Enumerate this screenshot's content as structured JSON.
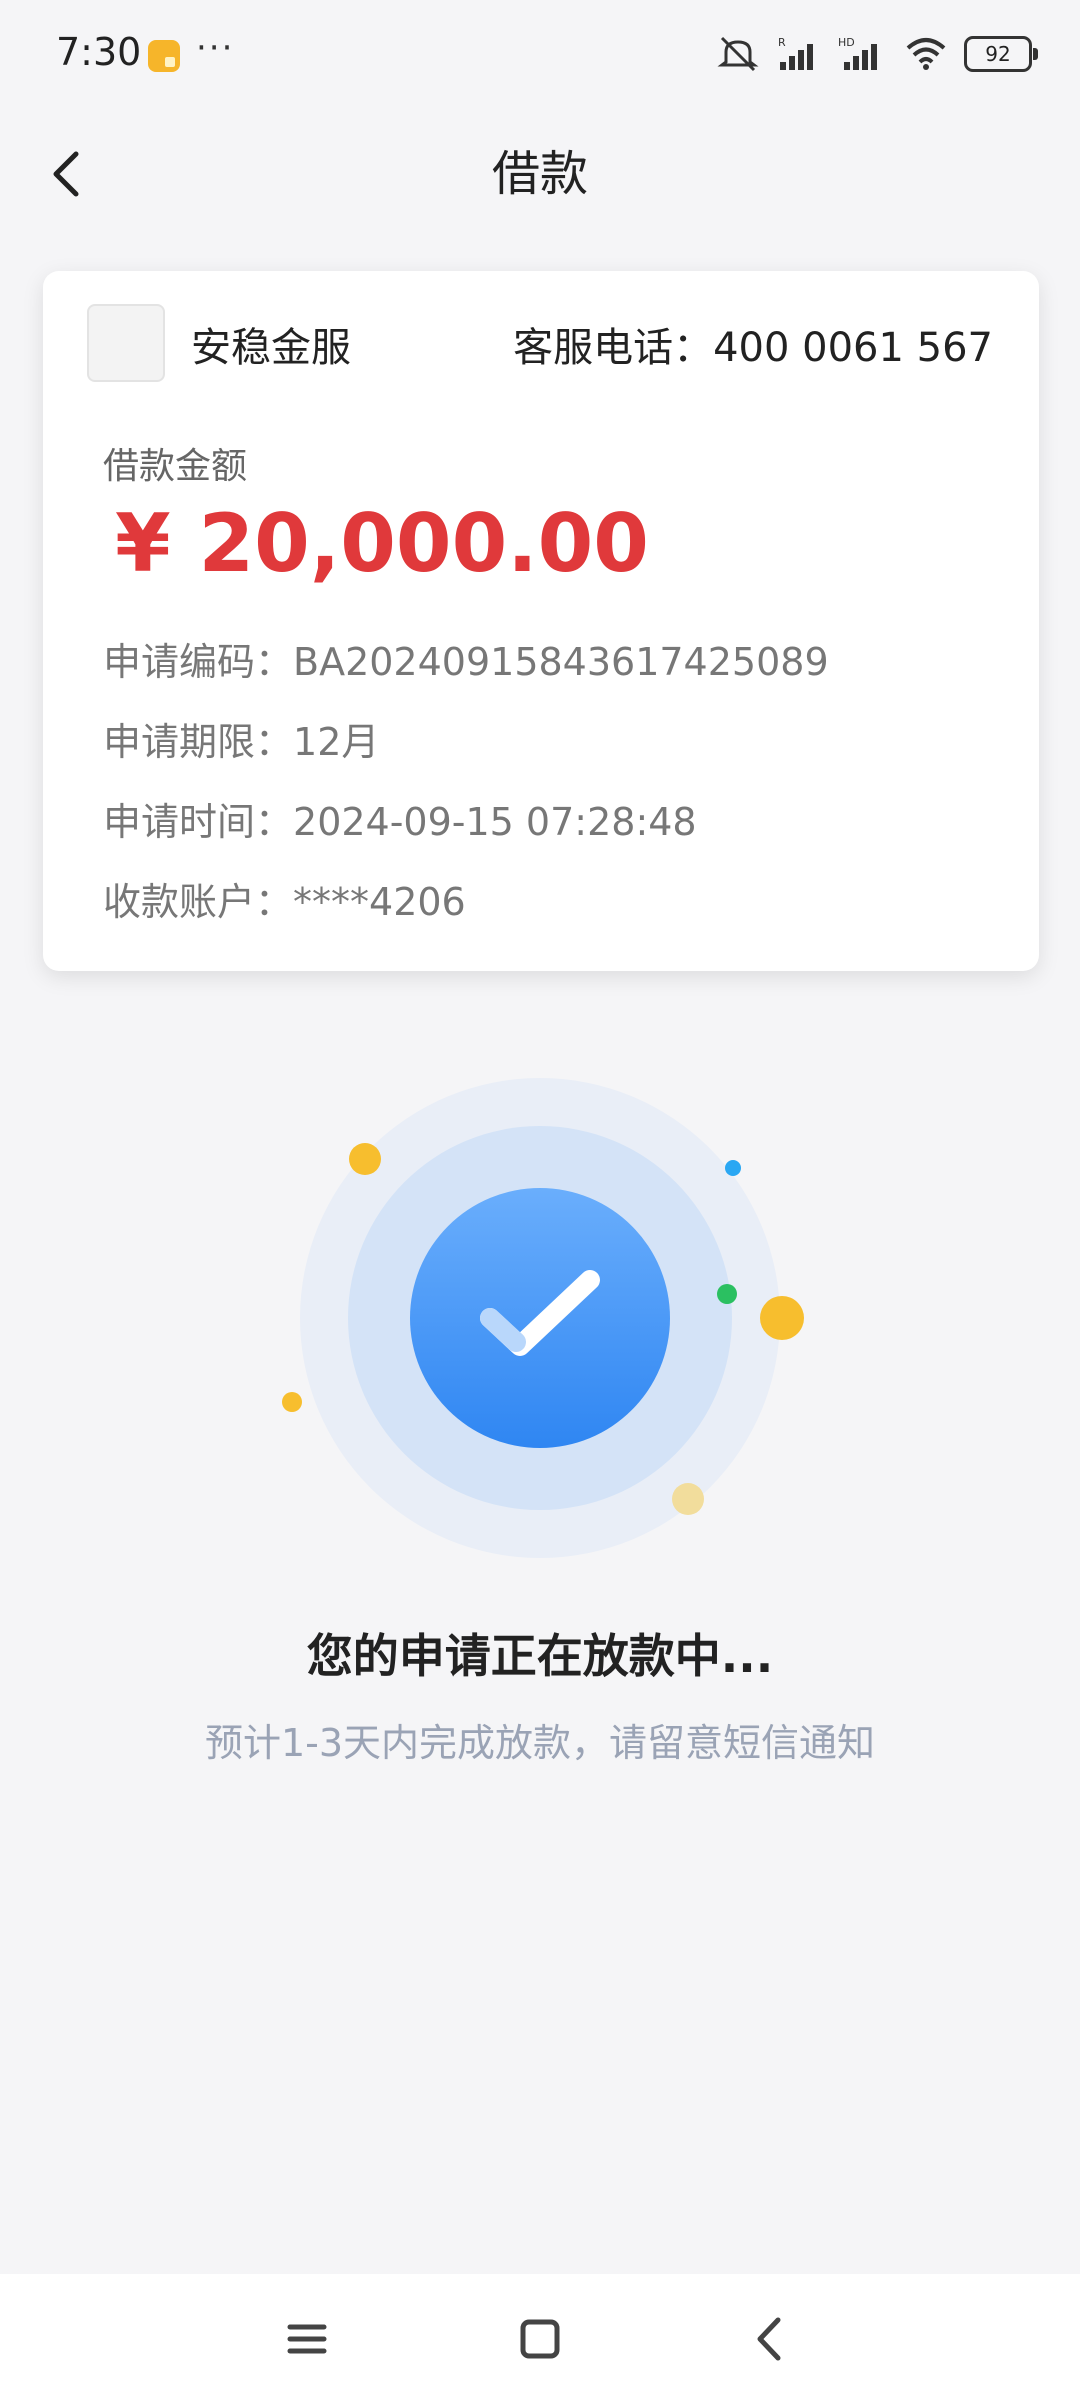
{
  "status_bar": {
    "time": "7:30",
    "dots": "···",
    "battery": "92",
    "icons": [
      "notification-icon",
      "mute-icon",
      "signal-r-icon",
      "signal-hd-icon",
      "wifi-icon",
      "battery-icon"
    ]
  },
  "header": {
    "title": "借款",
    "back_icon": "chevron-left-icon"
  },
  "card": {
    "company": "安稳金服",
    "hotline": "客服电话：400 0061 567",
    "amount_label": "借款金额",
    "amount": "¥ 20,000.00",
    "rows": [
      {
        "label": "申请编码：",
        "value": "BA20240915843617425089"
      },
      {
        "label": "申请期限：",
        "value": "12月"
      },
      {
        "label": "申请时间：",
        "value": "2024-09-15 07:28:48"
      },
      {
        "label": "收款账户：",
        "value": "****4206"
      }
    ],
    "colors": {
      "amount": "#e0393b"
    }
  },
  "status": {
    "title": "您的申请正在放款中...",
    "subtitle": "预计1-3天内完成放款，请留意短信通知",
    "icon": "check-circle-icon",
    "colors": {
      "accent": "#3a8ef6"
    }
  },
  "navbar": {
    "icons": [
      "menu-icon",
      "home-square-icon",
      "back-arrow-icon"
    ]
  }
}
